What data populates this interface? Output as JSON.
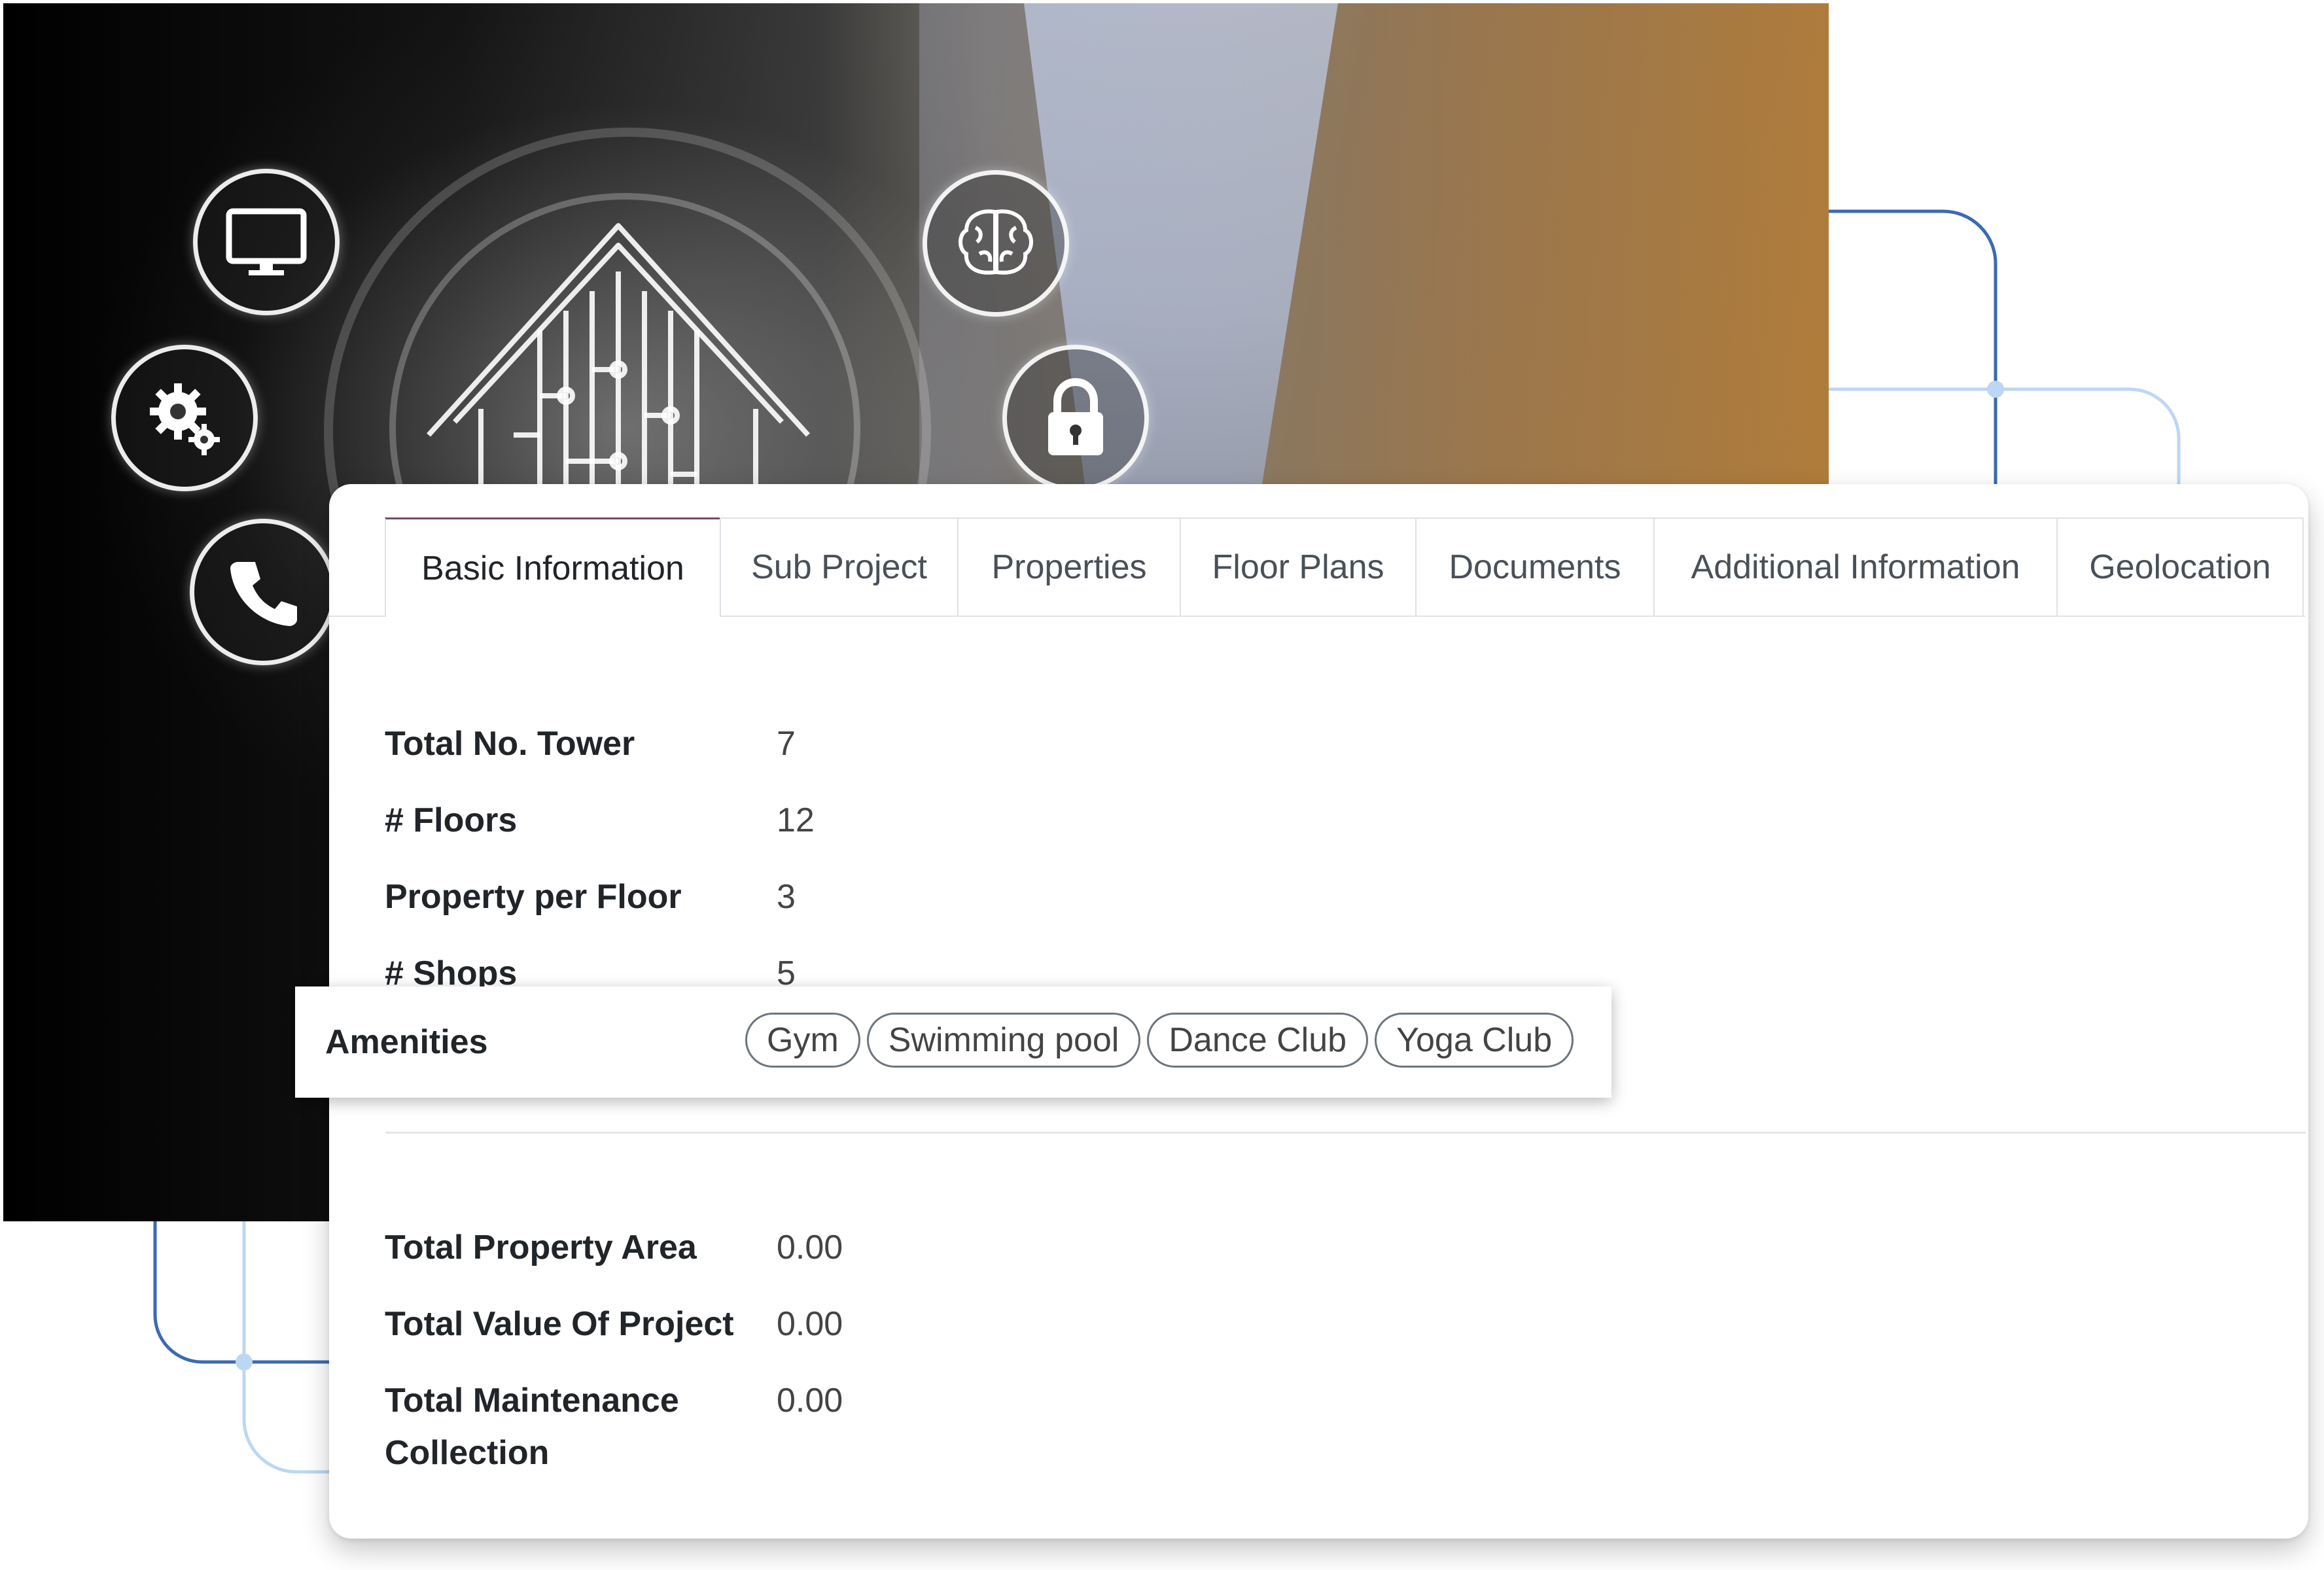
{
  "tabs": [
    {
      "label": "Basic Information",
      "active": true
    },
    {
      "label": "Sub Project"
    },
    {
      "label": "Properties"
    },
    {
      "label": "Floor Plans"
    },
    {
      "label": "Documents"
    },
    {
      "label": "Additional Information"
    },
    {
      "label": "Geolocation"
    }
  ],
  "basic": {
    "total_towers_label": "Total No. Tower",
    "total_towers_value": "7",
    "floors_label": "# Floors",
    "floors_value": "12",
    "property_per_floor_label": "Property per Floor",
    "property_per_floor_value": "3",
    "shops_label": "# Shops",
    "shops_value": "5"
  },
  "amenities": {
    "label": "Amenities",
    "tags": [
      "Gym",
      "Swimming pool",
      "Dance Club",
      "Yoga Club"
    ]
  },
  "totals": {
    "area_label": "Total Property Area",
    "area_value": "0.00",
    "project_value_label": "Total Value Of Project",
    "project_value_value": "0.00",
    "maintenance_label_line1": "Total Maintenance",
    "maintenance_label_line2": "Collection",
    "maintenance_value": "0.00"
  },
  "hero_icons": [
    "monitor-icon",
    "gear-icon",
    "phone-icon",
    "smart-home-icon",
    "brain-icon",
    "lock-icon"
  ],
  "colors": {
    "tab_active_accent": "#714b67",
    "circuit_line_dark": "#3c6ab2",
    "circuit_line_light": "#bcd7f3"
  }
}
